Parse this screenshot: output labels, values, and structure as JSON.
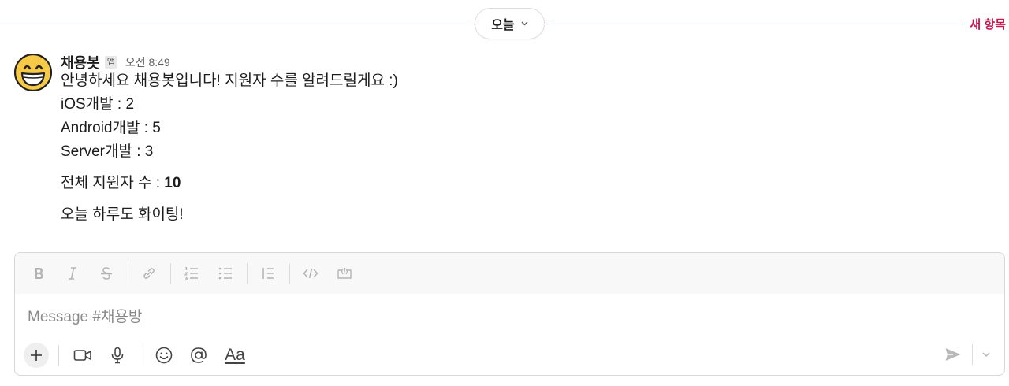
{
  "divider": {
    "date_label": "오늘",
    "new_label": "새 항목"
  },
  "message": {
    "sender": "채용봇",
    "badge": "앱",
    "time": "오전 8:49",
    "lines": [
      "안녕하세요 채용봇입니다! 지원자 수를 알려드릴게요 :)",
      "iOS개발 : 2",
      "Android개발 : 5",
      "Server개발 : 3"
    ],
    "total_label": "전체 지원자 수 : ",
    "total_value": "10",
    "closing": "오늘 하루도 화이팅!"
  },
  "composer": {
    "placeholder": "Message #채용방",
    "aa_label": "Aa",
    "toolbar": [
      "bold-icon",
      "italic-icon",
      "strikethrough-icon",
      "link-icon",
      "ordered-list-icon",
      "bulleted-list-icon",
      "blockquote-icon",
      "code-icon",
      "code-block-icon"
    ],
    "actions": [
      "plus-icon",
      "video-icon",
      "microphone-icon",
      "emoji-icon",
      "mention-icon",
      "format-text-icon",
      "send-icon",
      "chevron-down-icon"
    ]
  },
  "colors": {
    "divider_accent": "#c7164f",
    "text": "#1d1c1d",
    "muted": "#616061",
    "toolbar_icon": "#b3b3b3",
    "avatar_yellow": "#f7c948"
  }
}
